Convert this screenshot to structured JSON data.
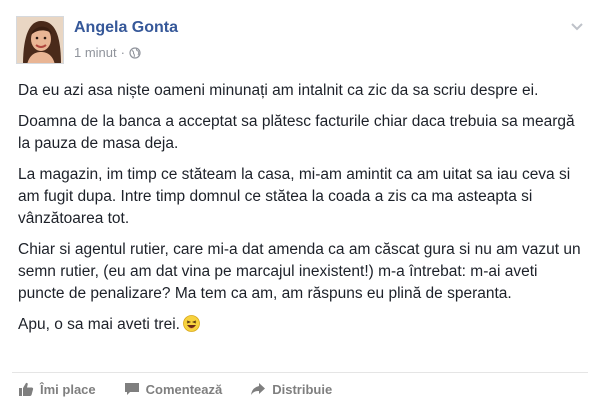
{
  "post": {
    "author": "Angela Gonta",
    "timestamp": "1 minut",
    "separator": "·",
    "paragraphs": [
      "Da eu azi asa niște oameni minunați am intalnit ca zic da sa scriu despre ei.",
      "Doamna de la banca a acceptat sa plătesc facturile chiar daca trebuia sa meargă la pauza de masa deja.",
      "La magazin, im timp ce stăteam la casa, mi-am amintit ca am uitat sa iau ceva si am fugit dupa. Intre timp domnul ce stătea la coada a zis ca ma asteapta si vânzătoarea tot.",
      "Chiar si agentul rutier, care mi-a dat amenda ca am căscat gura si nu am vazut un semn rutier, (eu am dat vina pe marcajul inexistent!) m-a întrebat: m-ai aveti puncte de penalizare? Ma tem ca am, am răspuns eu plină de speranta."
    ],
    "last_line": "Apu, o sa mai aveti trei."
  },
  "actions": {
    "like": "Îmi place",
    "comment": "Comentează",
    "share": "Distribuie"
  },
  "icons": {
    "privacy": "globe-icon",
    "menu": "chevron-down-icon",
    "emoji": "laughing-emoji-icon",
    "like": "thumbs-up-icon",
    "comment": "comment-icon",
    "share": "share-arrow-icon"
  },
  "colors": {
    "author": "#365899",
    "meta": "#90949c",
    "text": "#1d2129",
    "action": "#7f7f7f"
  }
}
